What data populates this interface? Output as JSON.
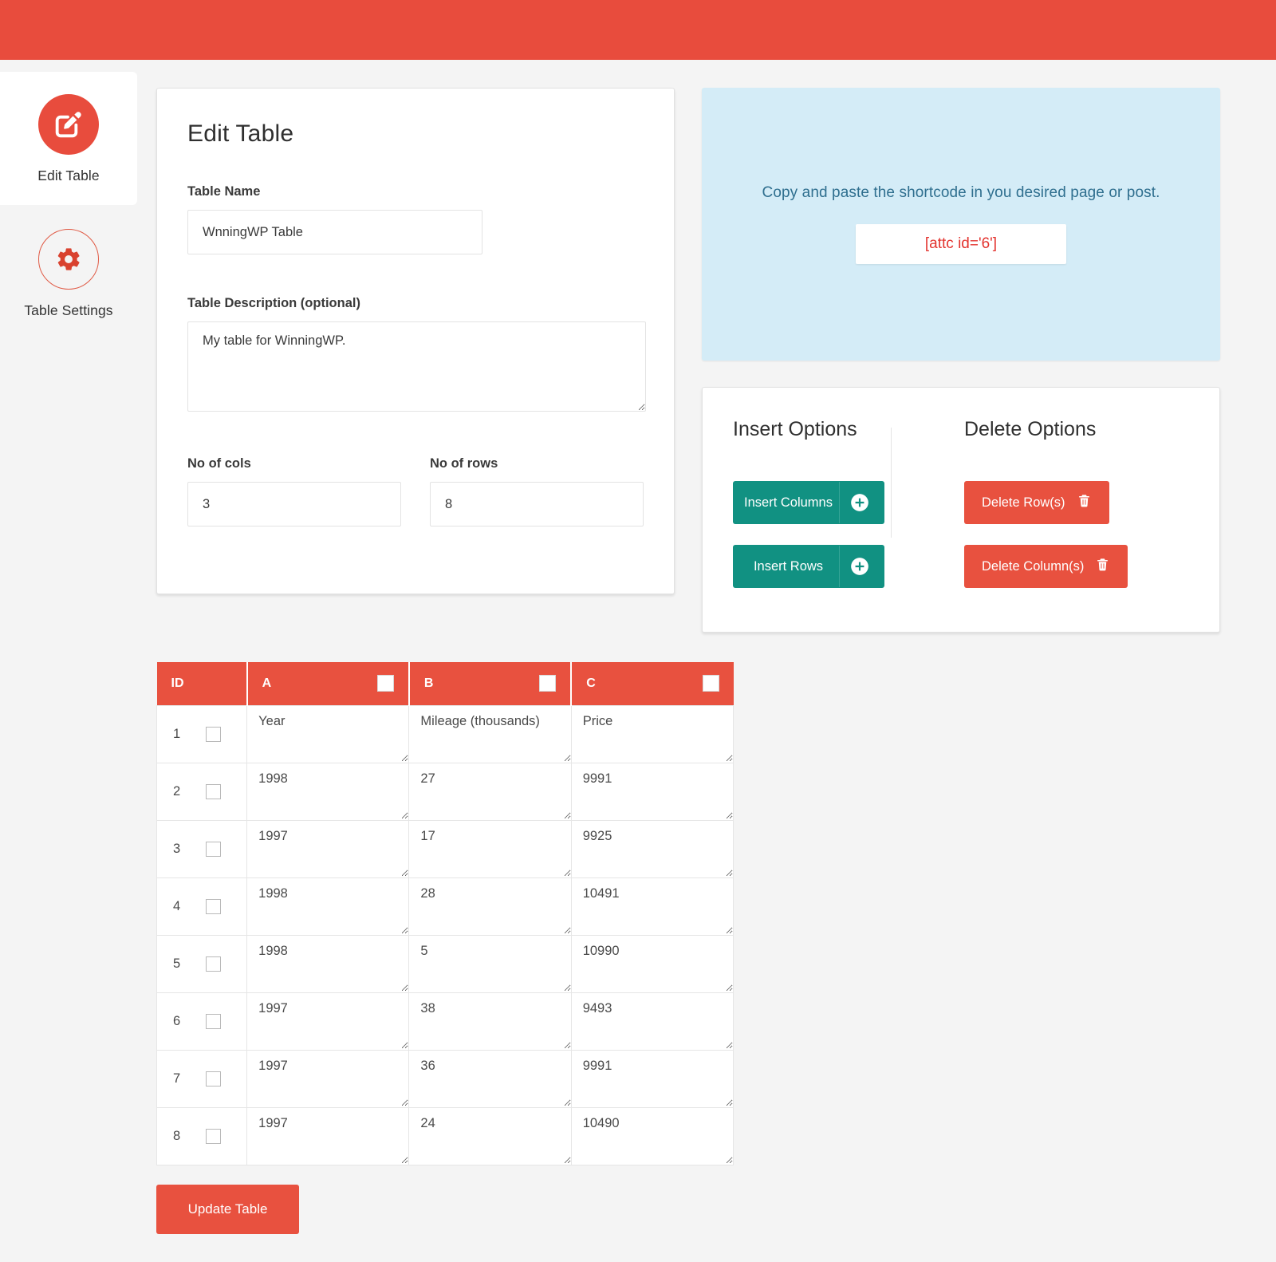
{
  "theme": {
    "accent_red": "#e8513f",
    "topbar_red": "#e84c3d",
    "teal": "#119182",
    "info_blue_bg": "#d4ecf7",
    "info_blue_text": "#2f6f8f",
    "shortcode_red": "#e3342f",
    "page_bg": "#f4f4f4"
  },
  "sidebar": {
    "items": [
      {
        "label": "Edit Table",
        "icon": "edit-square-pencil-icon",
        "active": true
      },
      {
        "label": "Table Settings",
        "icon": "gear-icon",
        "active": false
      }
    ]
  },
  "edit_card": {
    "title": "Edit Table",
    "table_name": {
      "label": "Table Name",
      "value": "WnningWP Table",
      "placeholder": "Table Name"
    },
    "table_description": {
      "label": "Table Description (optional)",
      "value": "My table for WinningWP.",
      "placeholder": "Table Description"
    },
    "no_of_cols": {
      "label": "No of cols",
      "value": "3",
      "placeholder": ""
    },
    "no_of_rows": {
      "label": "No of rows",
      "value": "8",
      "placeholder": ""
    }
  },
  "shortcode_panel": {
    "instruction": "Copy and paste the shortcode in you desired page or post.",
    "shortcode": "[attc id='6']"
  },
  "options_panel": {
    "insert_heading": "Insert Options",
    "delete_heading": "Delete Options",
    "insert_columns_label": "Insert Columns",
    "insert_rows_label": "Insert Rows",
    "delete_rows_label": "Delete Row(s)",
    "delete_columns_label": "Delete Column(s)",
    "plus_icon": "plus-circle-icon",
    "trash_icon": "trash-icon"
  },
  "data_table": {
    "headers": [
      {
        "label": "ID",
        "has_checkbox": false
      },
      {
        "label": "A",
        "has_checkbox": true
      },
      {
        "label": "B",
        "has_checkbox": true
      },
      {
        "label": "C",
        "has_checkbox": true
      }
    ],
    "rows": [
      {
        "id": "1",
        "a": "Year",
        "b": "Mileage (thousands)",
        "c": "Price"
      },
      {
        "id": "2",
        "a": "1998",
        "b": "27",
        "c": "9991"
      },
      {
        "id": "3",
        "a": "1997",
        "b": "17",
        "c": "9925"
      },
      {
        "id": "4",
        "a": "1998",
        "b": "28",
        "c": "10491"
      },
      {
        "id": "5",
        "a": "1998",
        "b": "5",
        "c": "10990"
      },
      {
        "id": "6",
        "a": "1997",
        "b": "38",
        "c": "9493"
      },
      {
        "id": "7",
        "a": "1997",
        "b": "36",
        "c": "9991"
      },
      {
        "id": "8",
        "a": "1997",
        "b": "24",
        "c": "10490"
      }
    ]
  },
  "footer": {
    "update_label": "Update Table"
  }
}
